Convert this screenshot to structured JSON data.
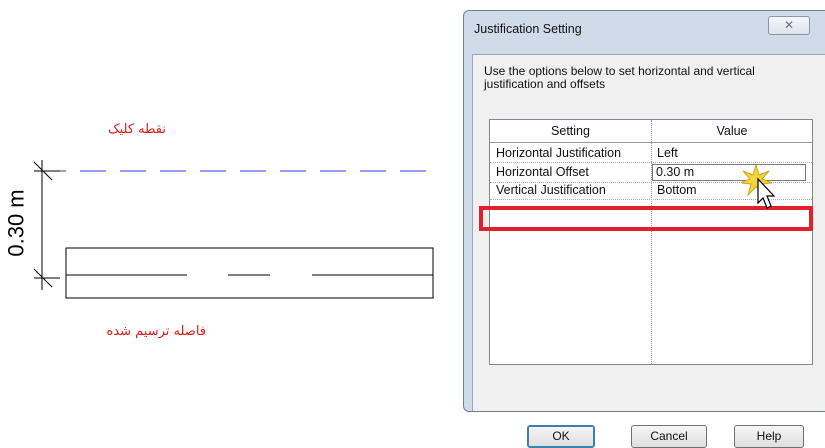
{
  "drawing": {
    "click_point_label": "نقطه کلیک",
    "drawn_distance_label": "فاصله ترسیم شده",
    "dimension_text": "0.30 m"
  },
  "dialog": {
    "title": "Justification Setting",
    "close_label": "X",
    "description": "Use the options below to set horizontal and vertical justification and offsets",
    "table": {
      "headers": [
        "Setting",
        "Value"
      ],
      "rows": [
        {
          "setting": "Horizontal Justification",
          "value": "Left"
        },
        {
          "setting": "Horizontal Offset",
          "value": "0.30 m"
        },
        {
          "setting": "Vertical Justification",
          "value": "Bottom"
        }
      ]
    },
    "buttons": {
      "ok": "OK",
      "cancel": "Cancel",
      "help": "Help"
    }
  },
  "colors": {
    "annotation": "#e01b1b",
    "dashed_line": "#3b3be0",
    "highlight": "#e0202a"
  }
}
